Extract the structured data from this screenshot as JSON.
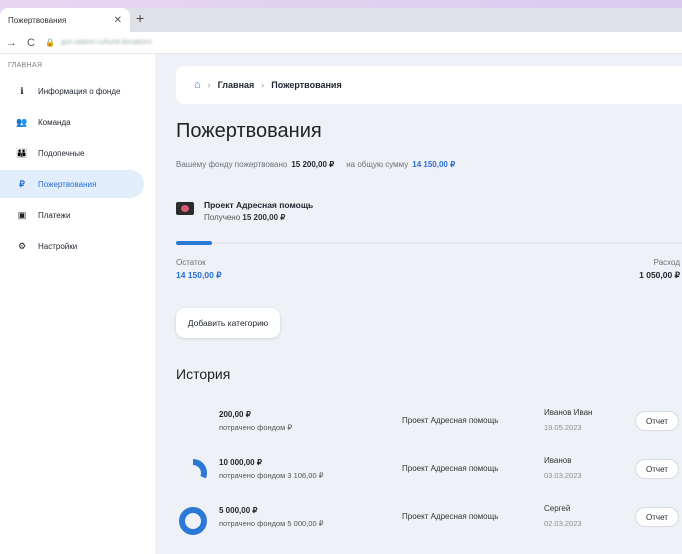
{
  "browser": {
    "tab_title": "Пожертвования",
    "close_glyph": "✕",
    "new_tab_glyph": "+",
    "back_glyph": "→",
    "reload_glyph": "C",
    "lock_glyph": "🔒",
    "url": "gun.sdamn.ru/fund-donations"
  },
  "sidebar": {
    "section": "ГЛАВНАЯ",
    "items": [
      {
        "label": "Информация о фонде",
        "icon": "info-icon",
        "glyph": "ℹ"
      },
      {
        "label": "Команда",
        "icon": "team-icon",
        "glyph": "👥"
      },
      {
        "label": "Подопечные",
        "icon": "wards-icon",
        "glyph": "👪"
      },
      {
        "label": "Пожертвования",
        "icon": "ruble-icon",
        "glyph": "₽",
        "active": true
      },
      {
        "label": "Платежи",
        "icon": "payments-icon",
        "glyph": "▣"
      },
      {
        "label": "Настройки",
        "icon": "gear-icon",
        "glyph": "⚙"
      }
    ]
  },
  "breadcrumb": {
    "home_glyph": "⌂",
    "sep": "›",
    "home": "Главная",
    "current": "Пожертвования"
  },
  "page_title": "Пожертвования",
  "summary": {
    "label1": "Вашему фонду пожертвовано",
    "value1": "15 200,00 ₽",
    "label2": "на общую сумму",
    "value2": "14 150,00 ₽"
  },
  "project": {
    "name": "Проект Адресная помощь",
    "received_label": "Получено",
    "received_value": "15 200,00 ₽",
    "progress_fraction": 0.07
  },
  "balance": {
    "left_label": "Остаток",
    "left_value": "14 150,00 ₽",
    "right_label": "Расход",
    "right_value": "1 050,00 ₽"
  },
  "add_category_label": "Добавить категорию",
  "history_title": "История",
  "history": [
    {
      "amount": "200,00 ₽",
      "spent": "потрачено фондом  ₽",
      "spent_fraction": 0.0,
      "project": "Проект Адресная помощь",
      "who": "Иванов Иван",
      "date": "19.05.2023",
      "report": "Отчет"
    },
    {
      "amount": "10 000,00 ₽",
      "spent": "потрачено фондом 3 106,00 ₽",
      "spent_fraction": 0.31,
      "project": "Проект Адресная помощь",
      "who": "Иванов",
      "date": "03.03.2023",
      "report": "Отчет"
    },
    {
      "amount": "5 000,00 ₽",
      "spent": "потрачено фондом 5 000,00 ₽",
      "spent_fraction": 1.0,
      "project": "Проект Адресная помощь",
      "who": "Сергей",
      "date": "02.03.2023",
      "report": "Отчет"
    }
  ],
  "colors": {
    "accent": "#2b78d6",
    "track": "#eef2fb",
    "active_bg": "#e2eefb"
  }
}
